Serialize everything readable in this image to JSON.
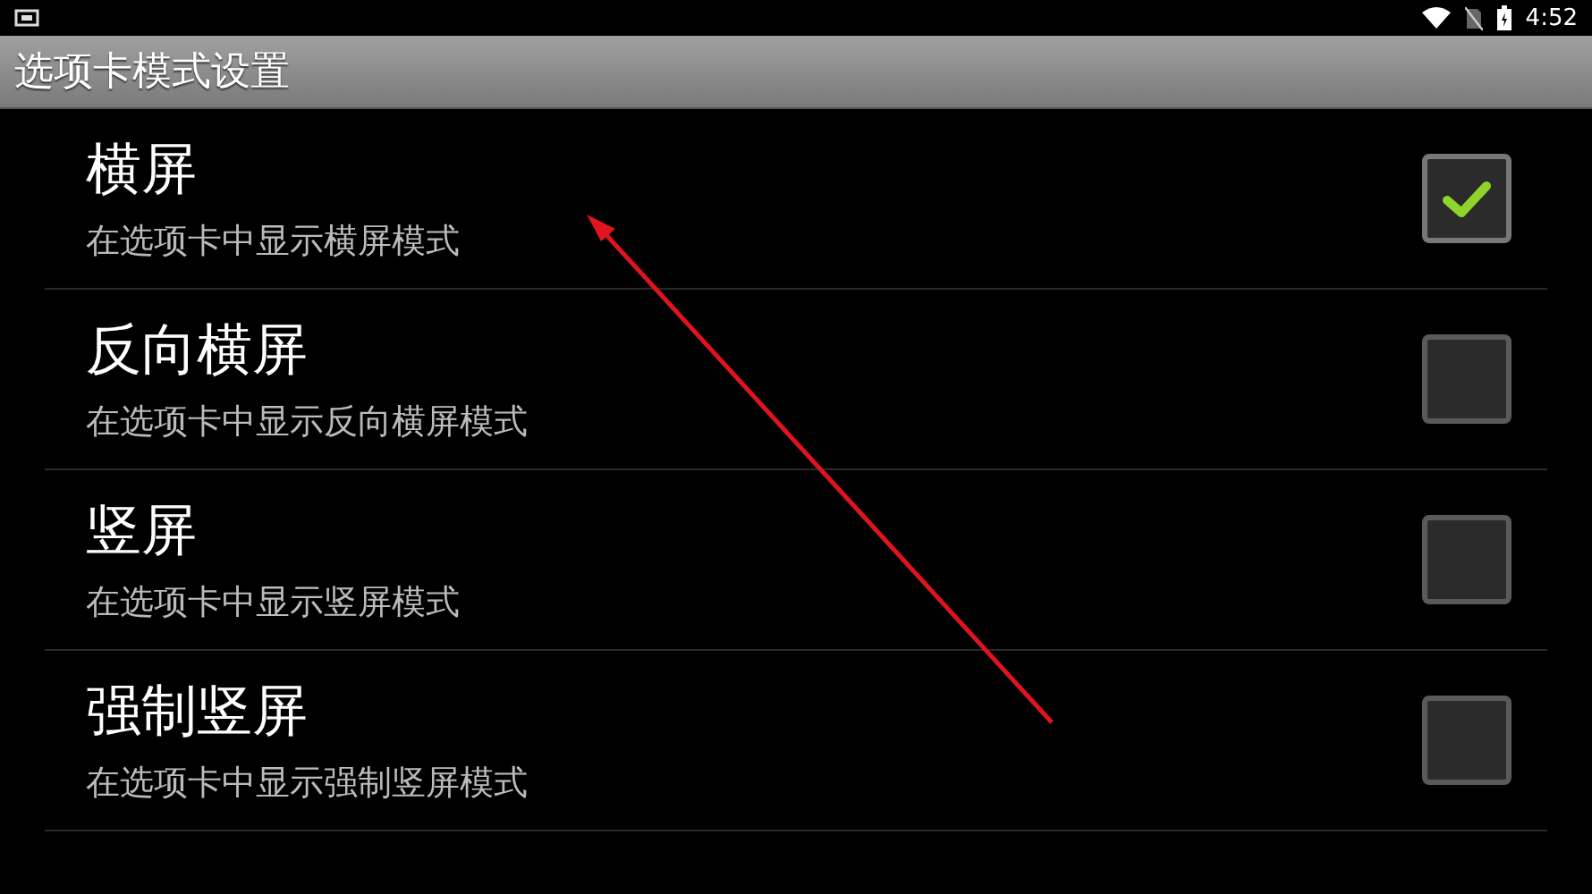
{
  "status_bar": {
    "time": "4:52"
  },
  "title_bar": {
    "title": "选项卡模式设置"
  },
  "settings": [
    {
      "title": "横屏",
      "summary": "在选项卡中显示横屏模式",
      "checked": true
    },
    {
      "title": "反向横屏",
      "summary": "在选项卡中显示反向横屏模式",
      "checked": false
    },
    {
      "title": "竖屏",
      "summary": "在选项卡中显示竖屏模式",
      "checked": false
    },
    {
      "title": "强制竖屏",
      "summary": "在选项卡中显示强制竖屏模式",
      "checked": false
    }
  ]
}
